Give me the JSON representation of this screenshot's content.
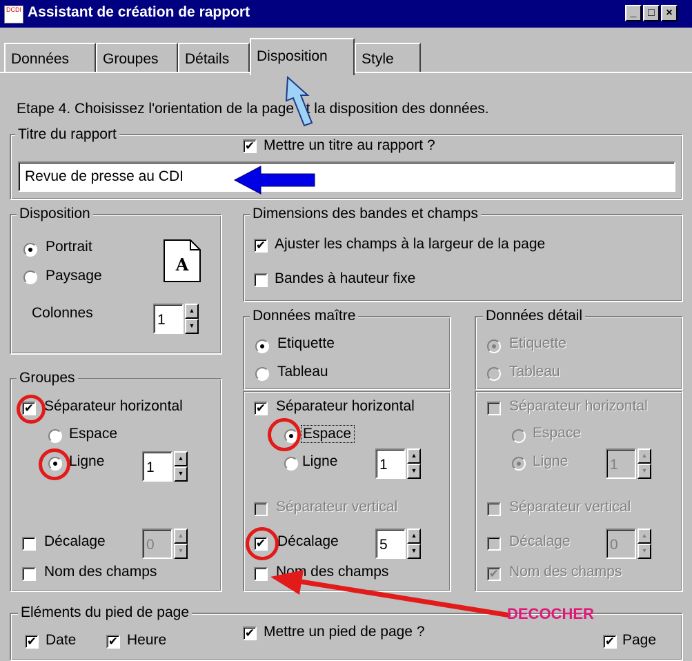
{
  "window": {
    "title": "Assistant de création de rapport",
    "app_icon_text": "DCDI",
    "minimize": "_",
    "maximize": "□",
    "close": "×"
  },
  "tabs": [
    {
      "label": "Données",
      "active": false
    },
    {
      "label": "Groupes",
      "active": false
    },
    {
      "label": "Détails",
      "active": false
    },
    {
      "label": "Disposition",
      "active": true
    },
    {
      "label": "Style",
      "active": false
    }
  ],
  "step_text": "Etape 4. Choisissez l'orientation de la page et la disposition des données.",
  "report_title": {
    "legend": "Titre du rapport",
    "checkbox_label": "Mettre un titre au rapport ?",
    "checked": true,
    "value": "Revue de presse au CDI"
  },
  "disposition": {
    "legend": "Disposition",
    "portrait": "Portrait",
    "paysage": "Paysage",
    "selected": "Portrait",
    "page_icon_letter": "A",
    "colonnes_label": "Colonnes",
    "colonnes_value": "1"
  },
  "dimensions": {
    "legend": "Dimensions des bandes et champs",
    "fit_label": "Ajuster les champs à la largeur de la page",
    "fit_checked": true,
    "fixed_label": "Bandes à hauteur fixe",
    "fixed_checked": false
  },
  "master": {
    "legend": "Données maître",
    "etiquette": "Etiquette",
    "tableau": "Tableau",
    "selected": "Etiquette",
    "sep_h_label": "Séparateur horizontal",
    "sep_h_checked": true,
    "espace": "Espace",
    "ligne": "Ligne",
    "sep_selected": "Espace",
    "ligne_value": "1",
    "sep_v_label": "Séparateur vertical",
    "decalage_label": "Décalage",
    "decalage_checked": true,
    "decalage_value": "5",
    "nom_champs_label": "Nom des champs",
    "nom_champs_checked": false
  },
  "detail": {
    "legend": "Données détail",
    "etiquette": "Etiquette",
    "tableau": "Tableau",
    "sep_h_label": "Séparateur horizontal",
    "espace": "Espace",
    "ligne": "Ligne",
    "ligne_value": "1",
    "sep_v_label": "Séparateur vertical",
    "decalage_label": "Décalage",
    "decalage_value": "0",
    "nom_champs_label": "Nom des champs",
    "nom_champs_checked": true
  },
  "groupes": {
    "legend": "Groupes",
    "sep_h_label": "Séparateur horizontal",
    "sep_h_checked": true,
    "espace": "Espace",
    "ligne": "Ligne",
    "sep_selected": "Ligne",
    "ligne_value": "1",
    "decalage_label": "Décalage",
    "decalage_checked": false,
    "decalage_value": "0",
    "nom_champs_label": "Nom des champs",
    "nom_champs_checked": false
  },
  "footer": {
    "legend": "Eléments du pied de page",
    "date_label": "Date",
    "heure_label": "Heure",
    "page_label": "Page",
    "checkbox_label": "Mettre un pied de page ?"
  },
  "annotations": {
    "decocher": "DECOCHER",
    "ring_color": "#e21a1a",
    "text_color": "#e0187a",
    "arrow_blue": "#0000e6",
    "arrow_lightblue": "#9fd3f5"
  },
  "check_mark": "✔"
}
